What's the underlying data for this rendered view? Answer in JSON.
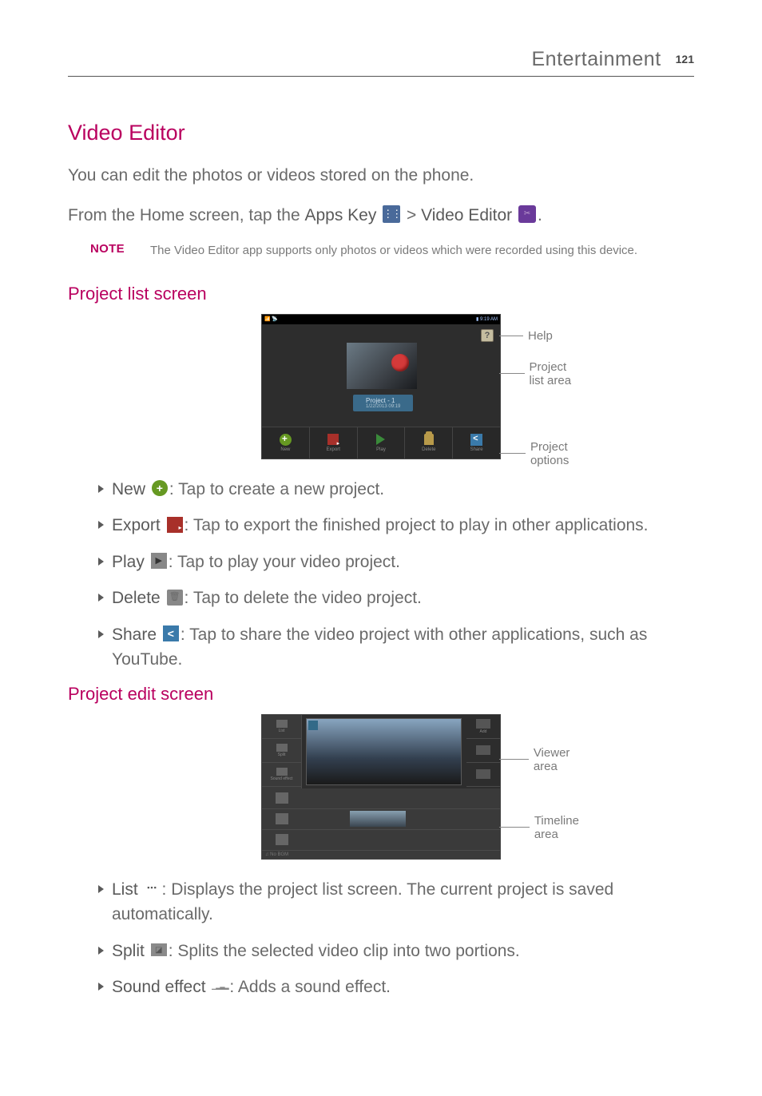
{
  "header": {
    "section": "Entertainment",
    "page": "121"
  },
  "title": "Video Editor",
  "intro": "You can edit the photos or videos stored on the phone.",
  "nav_line": {
    "prefix": "From the Home screen, tap the ",
    "apps_key": "Apps Key",
    "sep": " > ",
    "video_editor": "Video Editor",
    "suffix": "."
  },
  "note": {
    "label": "NOTE",
    "body": "The Video Editor app supports only photos or videos which were recorded using this device."
  },
  "section1": {
    "heading": "Project list screen",
    "status_left": "📶 📡",
    "status_right": "▮ 9:19 AM",
    "help": "?",
    "project_label": "Project - 1",
    "project_date": "1/22/2013 09:19",
    "toolbar": {
      "new": "New",
      "export": "Export",
      "play": "Play",
      "delete": "Delete",
      "share": "Share"
    },
    "callouts": {
      "help": "Help",
      "list_area": "Project list area",
      "options": "Project options"
    },
    "bullets": {
      "new": {
        "lead": "New",
        "body": ": Tap to create a new project."
      },
      "export": {
        "lead": "Export",
        "body": ": Tap to export the finished project to play in other applications."
      },
      "play": {
        "lead": "Play",
        "body": ": Tap to play your video project."
      },
      "delete": {
        "lead": "Delete",
        "body": ": Tap to delete the video project."
      },
      "share": {
        "lead": "Share",
        "body": ": Tap to share the video project with other applications, such as YouTube."
      }
    }
  },
  "section2": {
    "heading": "Project edit screen",
    "side": {
      "list": "List",
      "split": "Split",
      "sound": "Sound effect"
    },
    "rside": {
      "add": "Add"
    },
    "bgm": "♫ No BGM",
    "callouts": {
      "viewer": "Viewer area",
      "timeline": "Timeline area"
    },
    "bullets": {
      "list": {
        "lead": "List",
        "body": ": Displays the project list screen. The current project is saved automatically."
      },
      "split": {
        "lead": "Split",
        "body": ": Splits the selected video clip into two portions."
      },
      "sound": {
        "lead": "Sound effect",
        "body": ": Adds a sound effect."
      }
    }
  }
}
